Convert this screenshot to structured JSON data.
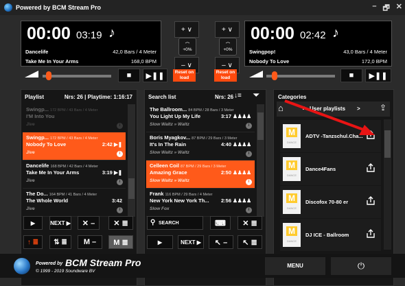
{
  "window": {
    "title": "Powered by BCM Stream Pro",
    "min": "–",
    "restore": "🗗",
    "close": "✕"
  },
  "deckA": {
    "time": "00:00",
    "remaining": "03:19",
    "note": "♪",
    "artist": "Dancelife",
    "bars": "42,0 Bars / 4 Meter",
    "title": "Take Me In Your Arms",
    "bpm": "168,0 BPM"
  },
  "deckB": {
    "time": "00:00",
    "remaining": "02:42",
    "note": "♪",
    "artist": "Swingpop!",
    "bars": "43,0 Bars / 4 Meter",
    "title": "Nobody To Love",
    "bpm": "172,0 BPM"
  },
  "pitch": {
    "a": "+0%",
    "b": "+0%"
  },
  "transport": {
    "plus": "+ ∨",
    "minus": "– ∨",
    "stop": "■",
    "playpause": "▶❚❚",
    "reset": "Reset on load"
  },
  "playlist": {
    "title": "Playlist",
    "stats": "Nrs: 26 | Playtime: 1:16:17",
    "items": [
      {
        "artist": "Swingp...",
        "meta": "172 BPM / 43 Bars / 4 Meter",
        "title": "I'M Into You",
        "len": "",
        "cat": "Jive",
        "state": "dim"
      },
      {
        "artist": "Swingp...",
        "meta": "172 BPM / 43 Bars / 4 Meter",
        "title": "Nobody To Love",
        "len": "2:42 ▶❚",
        "cat": "Jive",
        "state": "sel"
      },
      {
        "artist": "Dancelife",
        "meta": "168 BPM / 42 Bars / 4 Meter",
        "title": "Take Me In Your Arms",
        "len": "3:19 ▶❚",
        "cat": "Jive",
        "state": ""
      },
      {
        "artist": "The Do...",
        "meta": "164 BPM / 41 Bars / 4 Meter",
        "title": "The Whole World",
        "len": "3:42",
        "cat": "Jive",
        "state": ""
      }
    ]
  },
  "searchlist": {
    "title": "Search list",
    "stats": "Nrs: 26",
    "items": [
      {
        "artist": "The Ballroom...",
        "meta": "84 BPM / 28 Bars / 3 Meter",
        "title": "You Light Up My Life",
        "len": "3:17 ♟♟♟♟",
        "cat": "Slow Waltz » Waltz",
        "state": ""
      },
      {
        "artist": "Boris  Myagkov...",
        "meta": "87 BPM / 29 Bars / 3 Meter",
        "title": "It's In The Rain",
        "len": "4:40 ♟♟♟♟",
        "cat": "Slow Waltz » Waltz",
        "state": ""
      },
      {
        "artist": "Celleen Coil",
        "meta": "87 BPM / 29 Bars / 3 Meter",
        "title": "Amazing Grace",
        "len": "2:50 ♟♟♟♟",
        "cat": "Slow Waltz » Waltz",
        "state": "sel"
      },
      {
        "artist": "Frank",
        "meta": "116 BPM / 29 Bars / 4 Meter",
        "title": "New York New York Th...",
        "len": "2:56 ♟♟♟♟",
        "cat": "Slow Fox",
        "state": ""
      }
    ]
  },
  "plControls": {
    "play": "▶",
    "next": "NEXT ▶",
    "remove": "✕ –",
    "removeall": "✕ ≣",
    "top": "↑ ≣",
    "shuffle": "⇅ ≣",
    "mminus": "M –",
    "mlist": "M ≣"
  },
  "slControls": {
    "search_placeholder": "SEARCH",
    "keyboard": "⌨",
    "clear": "✕ ≣",
    "play": "▶",
    "next": "NEXT ▶",
    "back": "↖ –",
    "backall": "↖ ≣"
  },
  "categories": {
    "title": "Categories",
    "path": "User playlists",
    "chev": ">",
    "items": [
      {
        "name": "ADTV -Tanzschul.Cha..."
      },
      {
        "name": "Dance4Fans"
      },
      {
        "name": "Discofox 70-80 er"
      },
      {
        "name": "DJ ICE - Ballroom"
      }
    ]
  },
  "logo_text": {
    "m": "M",
    "d": "DANCE"
  },
  "footer": {
    "powered": "Powered by",
    "brand": "BCM Stream Pro",
    "copy": "© 1999 - 2019 Soundware BV",
    "menu": "MENU",
    "power": "⏻"
  },
  "colors": {
    "accent": "#ff5a1a",
    "arrow": "#e81414"
  }
}
